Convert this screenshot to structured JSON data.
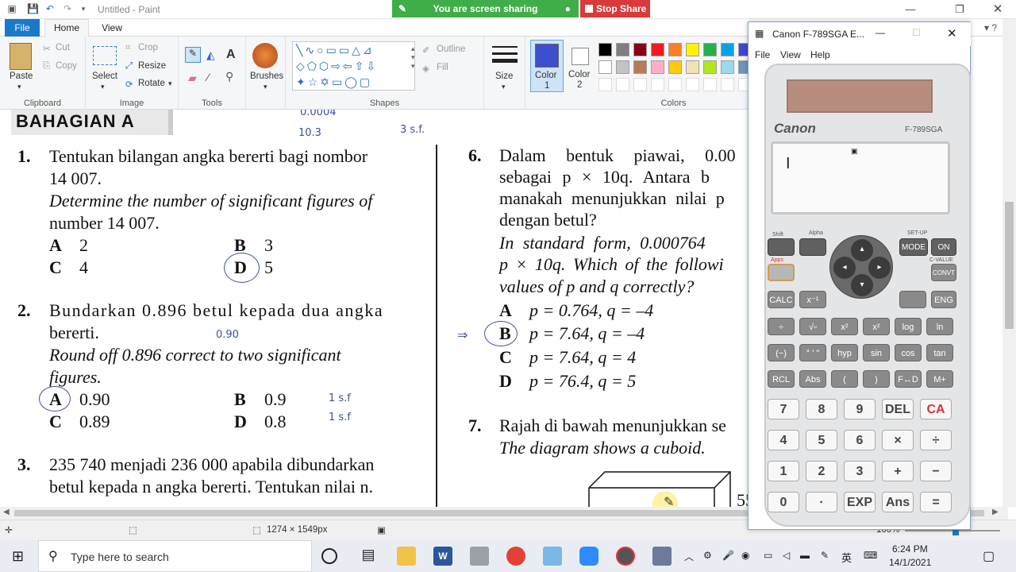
{
  "titlebar": {
    "title": "Untitled - Paint"
  },
  "sharing": {
    "message": "You are screen sharing",
    "stop_label": "Stop Share"
  },
  "tabs": {
    "file": "File",
    "home": "Home",
    "view": "View"
  },
  "ribbon": {
    "clipboard": {
      "label": "Clipboard",
      "paste": "Paste",
      "cut": "Cut",
      "copy": "Copy"
    },
    "image": {
      "label": "Image",
      "select": "Select",
      "crop": "Crop",
      "resize": "Resize",
      "rotate": "Rotate"
    },
    "tools": {
      "label": "Tools"
    },
    "brushes": {
      "label": "Brushes"
    },
    "shapes": {
      "label": "Shapes",
      "outline": "Outline",
      "fill": "Fill"
    },
    "size": {
      "label": "Size"
    },
    "color1": {
      "label": "Color",
      "num": "1",
      "value": "#3c4fcf"
    },
    "color2": {
      "label": "Color",
      "num": "2"
    },
    "colors": {
      "label": "Colors",
      "row1": [
        "#000000",
        "#7f7f7f",
        "#880015",
        "#ed1c24",
        "#ff7f27",
        "#fff200",
        "#22b14c",
        "#00a2e8",
        "#3f48cc"
      ],
      "row2": [
        "#ffffff",
        "#c3c3c3",
        "#b97a57",
        "#ffaec9",
        "#ffc90e",
        "#efe4b0",
        "#b5e61d",
        "#99d9ea",
        "#7092be"
      ]
    }
  },
  "document": {
    "section": "BAHAGIAN A",
    "q1": {
      "num": "1.",
      "ms1": "Tentukan bilangan angka bererti bagi nombor",
      "ms2": "14 007.",
      "en1": "Determine the number of significant figures of",
      "en2": "number 14 007.",
      "options": [
        {
          "l": "A",
          "v": "2"
        },
        {
          "l": "B",
          "v": "3"
        },
        {
          "l": "C",
          "v": "4"
        },
        {
          "l": "D",
          "v": "5"
        }
      ]
    },
    "q2": {
      "num": "2.",
      "ms1": "Bundarkan 0.896 betul kepada dua angka",
      "ms2": "bererti.",
      "en1": "Round off 0.896 correct to two significant",
      "en2": "figures.",
      "options": [
        {
          "l": "A",
          "v": "0.90"
        },
        {
          "l": "B",
          "v": "0.9"
        },
        {
          "l": "C",
          "v": "0.89"
        },
        {
          "l": "D",
          "v": "0.8"
        }
      ]
    },
    "q3": {
      "num": "3.",
      "ms1": "235 740 menjadi 236 000 apabila dibundarkan",
      "ms2": "betul kepada n angka bererti. Tentukan nilai n."
    },
    "q6": {
      "num": "6.",
      "ms1": "Dalam bentuk piawai, 0.00",
      "ms2": "sebagai p × 10q. Antara b",
      "ms3": "manakah menunjukkan nilai p",
      "ms4": "dengan betul?",
      "en1": "In standard form, 0.000764",
      "en2": "p × 10q. Which of the followi",
      "en3": "values of p and q correctly?",
      "options": [
        {
          "l": "A",
          "v": "p = 0.764, q = –4"
        },
        {
          "l": "B",
          "v": "p = 7.64, q = –4"
        },
        {
          "l": "C",
          "v": "p = 7.64, q = 4"
        },
        {
          "l": "D",
          "v": "p = 76.4, q = 5"
        }
      ]
    },
    "q7": {
      "num": "7.",
      "ms1": "Rajah di bawah menunjukkan se",
      "en1": "The diagram shows a cuboid.",
      "dim": "55"
    },
    "ink": {
      "a1": "0.0004",
      "a2": "10.3",
      "a3": "3 s.f.",
      "a4": "0.90",
      "a5": "1 s.f",
      "a6": "1 s.f"
    }
  },
  "status": {
    "size": "1274 × 1549px",
    "zoom": "100%"
  },
  "taskbar": {
    "search_placeholder": "Type here to search",
    "time": "6:24 PM",
    "date": "14/1/2021",
    "lang": "英"
  },
  "calculator": {
    "title": "Canon F-789SGA E...",
    "menu": [
      "File",
      "View",
      "Help"
    ],
    "brand": "Canon",
    "model": "F-789SGA",
    "display": "I",
    "keys_top": {
      "shift": "Shift",
      "alpha": "Alpha",
      "mode": "MODE",
      "on": "ON",
      "setup": "SET-UP",
      "cvalue": "C-VALUE",
      "convt": "CONVT",
      "apps": "Apps"
    },
    "row_a": [
      "CALC",
      "x⁻¹",
      "",
      "ENG"
    ],
    "row_b": [
      "÷",
      "√▫",
      "x²",
      "x²",
      "log",
      "ln"
    ],
    "row_c": [
      "(−)",
      "° ' \"",
      "hyp",
      "sin",
      "cos",
      "tan"
    ],
    "row_d": [
      "RCL",
      "Abs",
      "(",
      ")",
      "F↔D",
      "M+"
    ],
    "row_1": [
      "7",
      "8",
      "9",
      "DEL",
      "CA"
    ],
    "row_2": [
      "4",
      "5",
      "6",
      "×",
      "÷"
    ],
    "row_3": [
      "1",
      "2",
      "3",
      "+",
      "−"
    ],
    "row_4": [
      "0",
      "·",
      "EXP",
      "Ans",
      "="
    ]
  }
}
